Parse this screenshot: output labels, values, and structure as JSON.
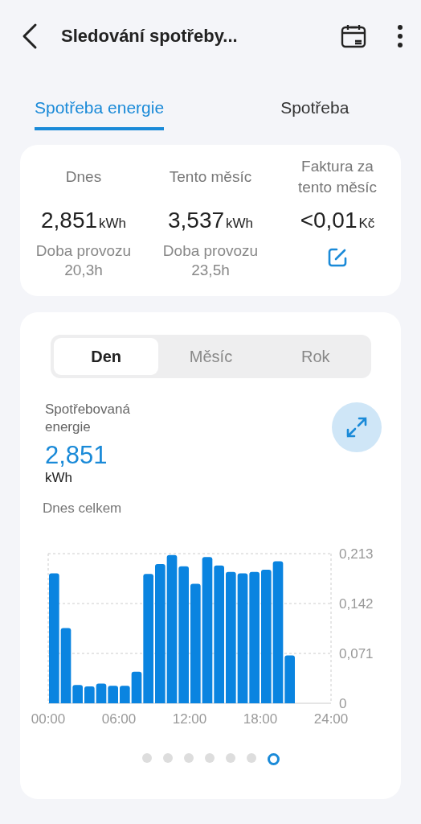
{
  "header": {
    "title": "Sledování spotřeby..."
  },
  "tabs": [
    {
      "label": "Spotřeba energie",
      "selected": true
    },
    {
      "label": "Spotřeba",
      "selected": false
    }
  ],
  "summary": [
    {
      "kind": "stat",
      "label": "Dnes",
      "value": "2,851",
      "unit": "kWh",
      "sub_label": "Doba provozu",
      "sub_value": "20,3h"
    },
    {
      "kind": "stat",
      "label": "Tento měsíc",
      "value": "3,537",
      "unit": "kWh",
      "sub_label": "Doba provozu",
      "sub_value": "23,5h"
    },
    {
      "kind": "invoice",
      "label": "Faktura za tento měsíc",
      "value": "<0,01",
      "unit": "Kč"
    }
  ],
  "periods": [
    {
      "label": "Den",
      "selected": true
    },
    {
      "label": "Měsíc",
      "selected": false
    },
    {
      "label": "Rok",
      "selected": false
    }
  ],
  "energy": {
    "label": "Spotřebovaná energie",
    "value": "2,851",
    "unit": "kWh",
    "caption": "Dnes celkem"
  },
  "chart_data": {
    "type": "bar",
    "x": [
      0.5,
      1.5,
      2.5,
      3.5,
      4.5,
      5.5,
      6.5,
      7.5,
      8.5,
      9.5,
      10.5,
      11.5,
      12.5,
      13.5,
      14.5,
      15.5,
      16.5,
      17.5,
      18.5,
      19.5,
      20.5
    ],
    "values": [
      0.185,
      0.107,
      0.026,
      0.024,
      0.028,
      0.025,
      0.025,
      0.045,
      0.184,
      0.198,
      0.211,
      0.195,
      0.17,
      0.208,
      0.196,
      0.187,
      0.185,
      0.187,
      0.19,
      0.202,
      0.068
    ],
    "xlim": [
      0,
      24
    ],
    "ylim": [
      0,
      0.213
    ],
    "xticks": [
      {
        "value": 0,
        "label": "00:00"
      },
      {
        "value": 6,
        "label": "06:00"
      },
      {
        "value": 12,
        "label": "12:00"
      },
      {
        "value": 18,
        "label": "18:00"
      },
      {
        "value": 24,
        "label": "24:00"
      }
    ],
    "yticks": [
      {
        "value": 0,
        "label": "0"
      },
      {
        "value": 0.071,
        "label": "0,071"
      },
      {
        "value": 0.142,
        "label": "0,142"
      },
      {
        "value": 0.213,
        "label": "0,213"
      }
    ]
  },
  "pages": [
    {
      "selected": false
    },
    {
      "selected": false
    },
    {
      "selected": false
    },
    {
      "selected": false
    },
    {
      "selected": false
    },
    {
      "selected": false
    },
    {
      "selected": true
    }
  ]
}
